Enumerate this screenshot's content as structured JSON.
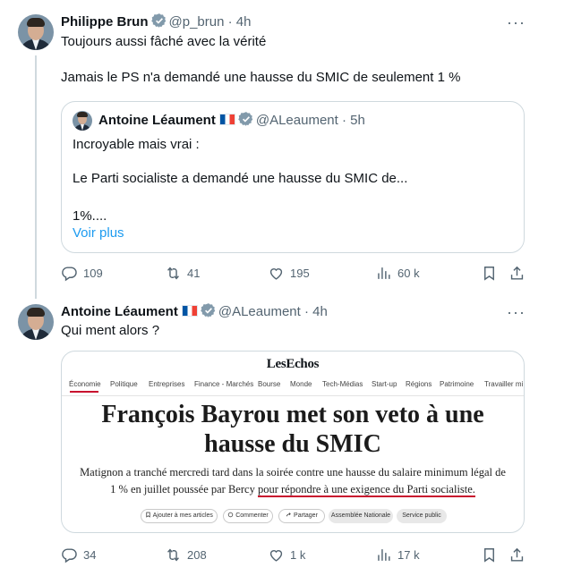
{
  "tweet1": {
    "name": "Philippe Brun",
    "handle": "@p_brun",
    "time": "4h",
    "line1": "Toujours aussi fâché avec la vérité",
    "line2": "Jamais le PS n'a demandé une hausse du SMIC de seulement 1 %",
    "quote": {
      "name": "Antoine Léaument",
      "flag": "🇫🇷",
      "handle": "@ALeaument",
      "time": "5h",
      "line1": "Incroyable mais vrai :",
      "line2": "Le Parti socialiste a demandé une hausse du SMIC de...",
      "line3": "1%....",
      "more": "Voir plus"
    },
    "actions": {
      "replies": "109",
      "reposts": "41",
      "likes": "195",
      "views": "60 k"
    }
  },
  "tweet2": {
    "name": "Antoine Léaument",
    "flag": "🇫🇷",
    "handle": "@ALeaument",
    "time": "4h",
    "text": "Qui ment alors ?",
    "article": {
      "brand": "LesEchos",
      "nav": [
        "Économie",
        "Politique",
        "Entreprises",
        "Finance - Marchés",
        "Bourse",
        "Monde",
        "Tech-Médias",
        "Start-up",
        "Régions",
        "Patrimoine",
        "Travailler mi"
      ],
      "headline_line1": "François Bayrou met son veto à une",
      "headline_line2": "hausse du SMIC",
      "lead_line1": "Matignon a tranché mercredi tard dans la soirée contre une hausse du salaire minimum légal de",
      "lead_line2_a": "1 % en juillet poussée par Bercy ",
      "lead_line2_b": "pour répondre à une exigence du Parti socialiste.",
      "chips": [
        "Ajouter à mes articles",
        "Commenter",
        "Partager",
        "Assemblée Nationale",
        "Service public"
      ]
    },
    "actions": {
      "replies": "34",
      "reposts": "208",
      "likes": "1 k",
      "views": "17 k"
    }
  },
  "colors": {
    "text": "#0f1419",
    "secondary": "#536471",
    "link": "#1d9bf0",
    "border": "#cfd9de",
    "verified": "#829aab",
    "echos_red": "#c8102e"
  }
}
